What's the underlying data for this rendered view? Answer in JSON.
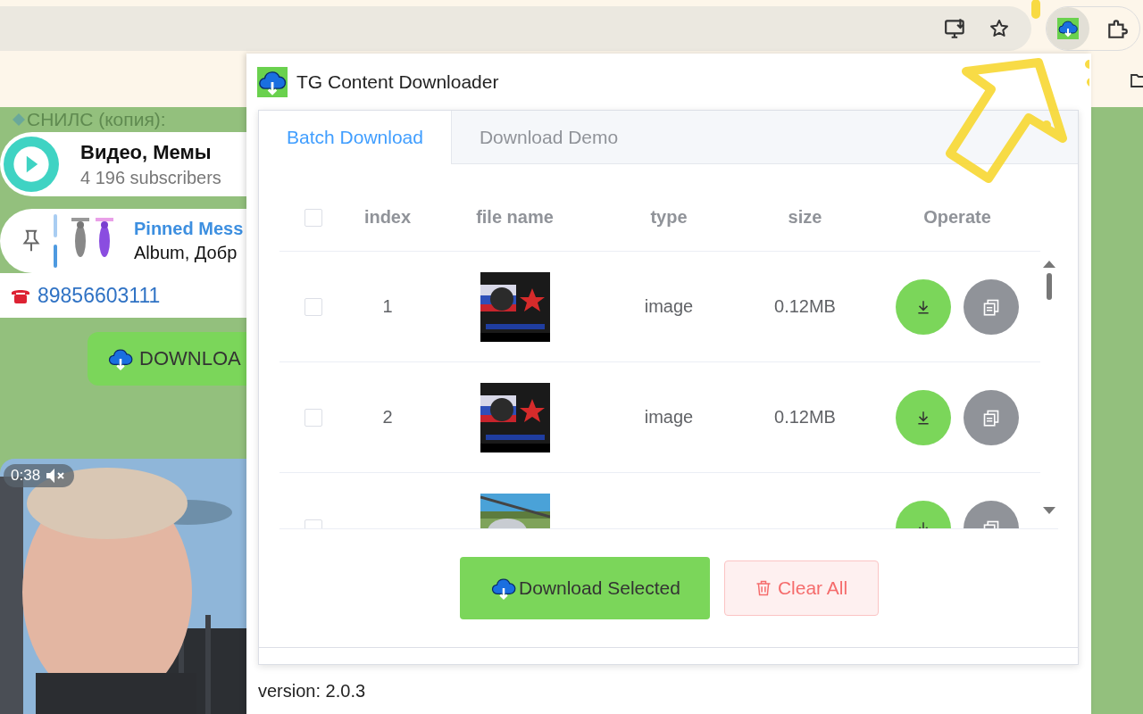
{
  "chat": {
    "snils_text": "СНИЛС (копия):",
    "channel": {
      "name": "Видео, Мемы",
      "subscribers": "4 196 subscribers"
    },
    "pinned": {
      "title": "Pinned Mess",
      "text": "Album, Добр"
    },
    "phone": "89856603111",
    "download_button": "DOWNLOA",
    "video": {
      "duration": "0:38",
      "muted": true
    }
  },
  "popup": {
    "title": "TG Content Downloader",
    "tabs": [
      {
        "label": "Batch Download",
        "selected": true
      },
      {
        "label": "Download Demo",
        "selected": false
      }
    ],
    "table": {
      "select_all": {
        "checked": false
      },
      "columns": [
        "index",
        "file name",
        "type",
        "size",
        "Operate"
      ],
      "rows": [
        {
          "selected": false,
          "index": "1",
          "type": "image",
          "size": "0.12MB"
        },
        {
          "selected": false,
          "index": "2",
          "type": "image",
          "size": "0.12MB"
        },
        {
          "selected": false
        }
      ]
    },
    "buttons": {
      "download_selected": "Download Selected",
      "clear_all": "Clear All"
    },
    "version": "version: 2.0.3"
  }
}
